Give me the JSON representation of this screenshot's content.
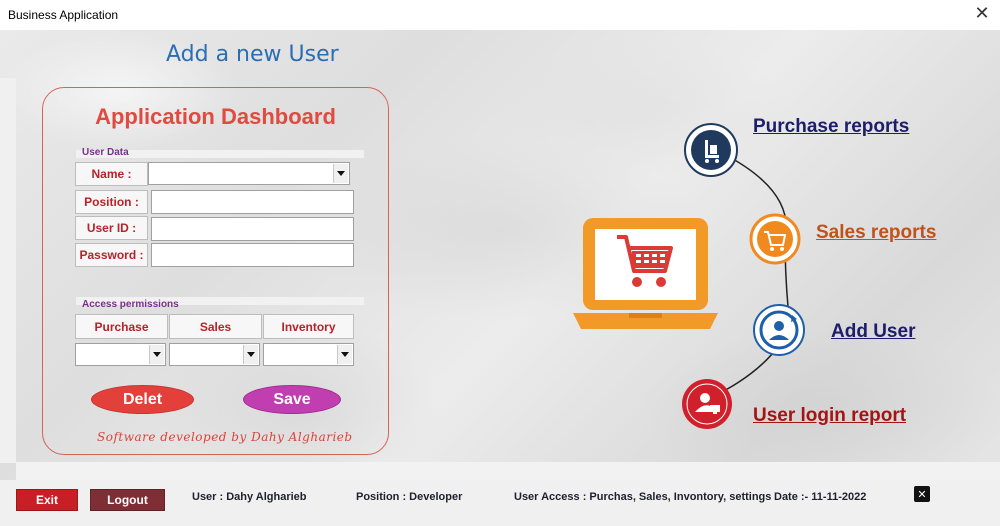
{
  "window": {
    "title": "Business Application",
    "close_glyph": "✕"
  },
  "page": {
    "heading": "Add a new User"
  },
  "dashboard": {
    "title": "Application Dashboard",
    "user_data_label": "User Data",
    "fields": {
      "name_label": "Name  :",
      "name_value": "",
      "position_label": "Position :",
      "position_value": "",
      "userid_label": "User ID  :",
      "userid_value": "",
      "password_label": "Password :",
      "password_value": ""
    },
    "permissions_label": "Access permissions",
    "permissions": {
      "purchase": "Purchase",
      "sales": "Sales",
      "inventory": "Inventory"
    },
    "delete_label": "Delet",
    "save_label": "Save",
    "credit": "Software developed by Dahy Algharieb"
  },
  "reports": {
    "purchase": {
      "label": "Purchase reports",
      "color": "#1d1d6b",
      "icon": "hand-truck-icon"
    },
    "sales": {
      "label": "Sales reports",
      "color": "#c0521a",
      "icon": "cart-icon"
    },
    "add_user": {
      "label": "Add User",
      "color": "#1d1d6b",
      "icon": "user-refresh-icon"
    },
    "login": {
      "label": "User login report",
      "color": "#a31515",
      "icon": "user-computer-icon"
    }
  },
  "footer": {
    "exit_label": "Exit",
    "logout_label": "Logout",
    "user": "User : Dahy Algharieb",
    "position": "Position : Developer",
    "access": "User Access : Purchas, Sales, Invontory, settings",
    "date": "Date :-  11-11-2022",
    "close_glyph": "✕"
  },
  "colors": {
    "accent_red": "#e04a3f",
    "navy": "#1f3a5c",
    "orange": "#f19a28",
    "blue": "#1d5fa8",
    "crimson": "#d0202c",
    "purple": "#c13eb0"
  }
}
